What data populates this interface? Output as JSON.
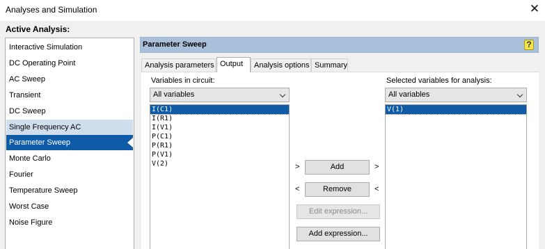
{
  "window": {
    "title": "Analyses and Simulation",
    "close_glyph": "✕"
  },
  "active_analysis_label": "Active Analysis:",
  "analyses": [
    {
      "label": "Interactive Simulation",
      "state": "normal"
    },
    {
      "label": "DC Operating Point",
      "state": "normal"
    },
    {
      "label": "AC Sweep",
      "state": "normal"
    },
    {
      "label": "Transient",
      "state": "normal"
    },
    {
      "label": "DC Sweep",
      "state": "normal"
    },
    {
      "label": "Single Frequency AC",
      "state": "hover"
    },
    {
      "label": "Parameter Sweep",
      "state": "selected"
    },
    {
      "label": "Monte Carlo",
      "state": "normal"
    },
    {
      "label": "Fourier",
      "state": "normal"
    },
    {
      "label": "Temperature Sweep",
      "state": "normal"
    },
    {
      "label": "Worst Case",
      "state": "normal"
    },
    {
      "label": "Noise Figure",
      "state": "normal"
    }
  ],
  "panel": {
    "title": "Parameter Sweep",
    "help_glyph": "?"
  },
  "tabs": [
    {
      "label": "Analysis parameters",
      "active": false
    },
    {
      "label": "Output",
      "active": true
    },
    {
      "label": "Analysis options",
      "active": false
    },
    {
      "label": "Summary",
      "active": false
    }
  ],
  "output": {
    "variables_label": "Variables in circuit:",
    "variables_filter": "All variables",
    "variables": [
      "I(C1)",
      "I(R1)",
      "I(V1)",
      "P(C1)",
      "P(R1)",
      "P(V1)",
      "V(2)"
    ],
    "variables_selected_index": 0,
    "selected_label": "Selected variables for analysis:",
    "selected_filter": "All variables",
    "selected_variables": [
      "V(1)"
    ],
    "selected_selected_index": 0,
    "add_button": "Add",
    "remove_button": "Remove",
    "edit_expression_button": "Edit expression...",
    "add_expression_button": "Add expression...",
    "arrow_right": ">",
    "arrow_left": "<"
  },
  "colors": {
    "selection": "#0f5ba8",
    "hover": "#cfdfee",
    "panel_header": "#a8c0d9",
    "help_icon": "#f4e24a"
  }
}
